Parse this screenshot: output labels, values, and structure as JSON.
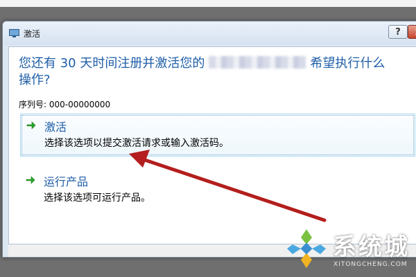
{
  "window": {
    "title": "激活",
    "help_label": "?",
    "close_label": "x"
  },
  "content": {
    "headline_part1": "您还有 30 天时间注册并激活您的",
    "headline_part2": "希望执行什么",
    "headline_part3": "操作?",
    "serial_label": "序列号: 000-00000000"
  },
  "options": [
    {
      "title": "激活",
      "desc": "选择该选项以提交激活请求或输入激活码。",
      "icon": "green-arrow-icon"
    },
    {
      "title": "运行产品",
      "desc": "选择该选项可运行产品。",
      "icon": "green-arrow-icon"
    }
  ],
  "watermark": {
    "text": "系统城",
    "sub": "XITONGCHENG.COM"
  },
  "colors": {
    "heading_blue": "#1f5ea8",
    "annotation_arrow": "#b41e1e",
    "option_arrow": "#2aa52a"
  }
}
